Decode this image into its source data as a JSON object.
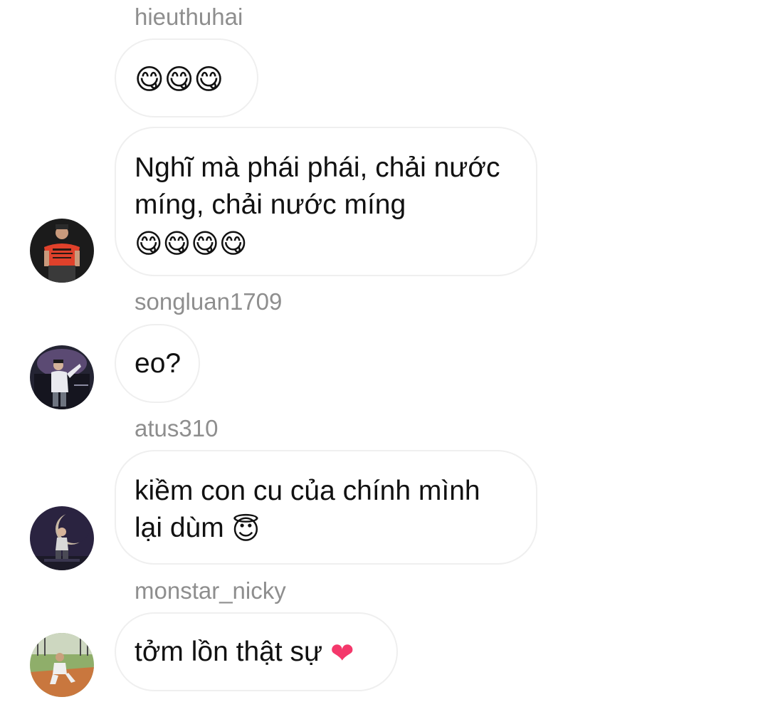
{
  "messages": [
    {
      "username": "hieuthuhai",
      "text": "",
      "emoji": "😋😋😋"
    },
    {
      "username": "",
      "text": "Nghĩ mà phái phái, chải nước míng, chải nước míng",
      "emoji": "😋😋😋😋"
    },
    {
      "username": "songluan1709",
      "text": "eo?",
      "emoji": ""
    },
    {
      "username": "atus310",
      "text": "kiềm con cu của chính mình lại dùm",
      "emoji": "😇"
    },
    {
      "username": "monstar_nicky",
      "text": "tởm lồn thật sự",
      "emoji": "❤"
    }
  ],
  "colors": {
    "username": "#8e8e8e",
    "bubble_border": "#efefef",
    "text": "#111111",
    "heart": "#f4386b"
  },
  "icons": {
    "yum_emoji": "face-savoring-food-emoji",
    "halo_emoji": "smiling-face-with-halo-emoji",
    "heart_emoji": "red-heart-emoji"
  }
}
